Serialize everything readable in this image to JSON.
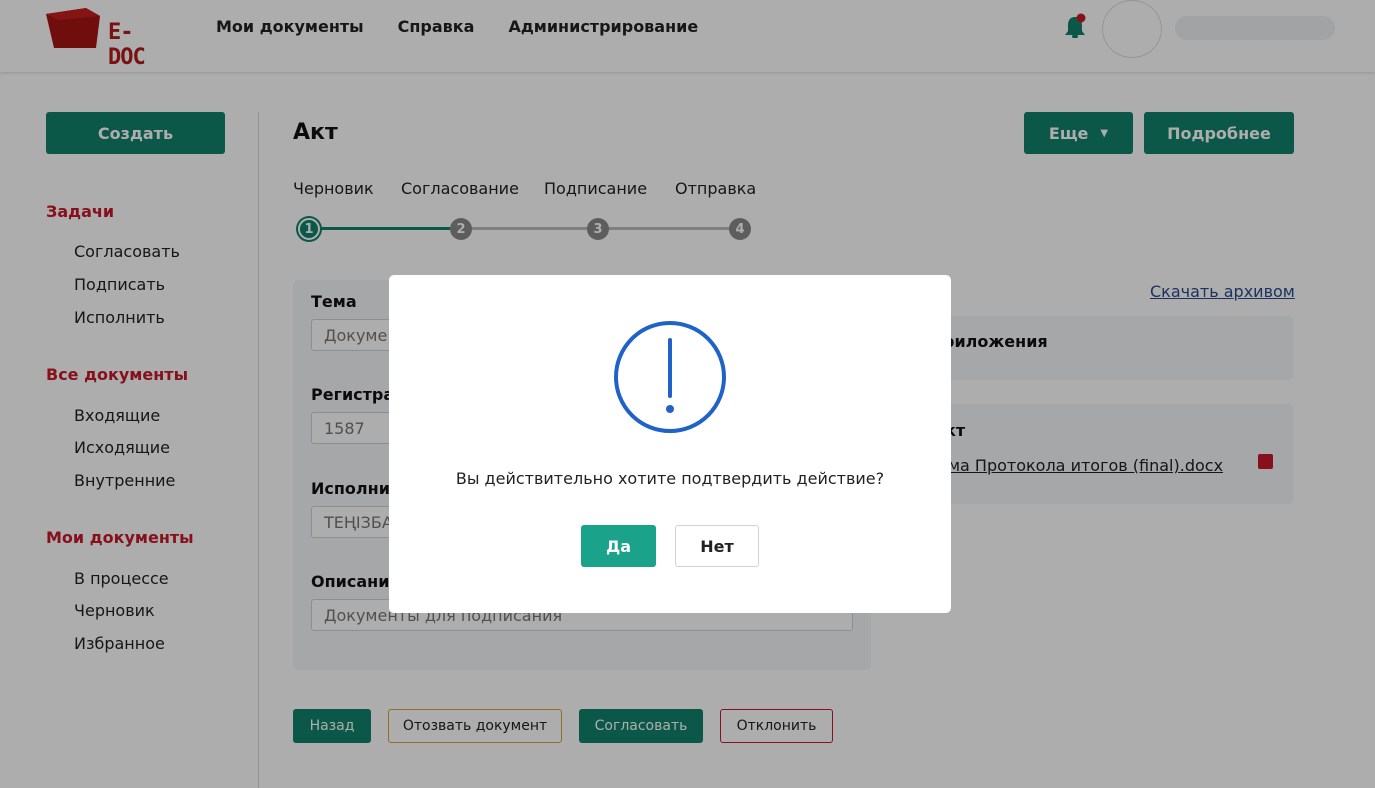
{
  "header": {
    "logo_text": "E-DOC",
    "nav": [
      "Мои документы",
      "Справка",
      "Администрирование"
    ]
  },
  "sidebar": {
    "create_label": "Создать",
    "sections": [
      {
        "title": "Задачи",
        "items": [
          "Согласовать",
          "Подписать",
          "Исполнить"
        ]
      },
      {
        "title": "Все документы",
        "items": [
          "Входящие",
          "Исходящие",
          "Внутренние"
        ]
      },
      {
        "title": "Мои документы",
        "items": [
          "В процессе",
          "Черновик",
          "Избранное"
        ]
      }
    ]
  },
  "main": {
    "title": "Акт",
    "more_label": "Еще",
    "details_label": "Подробнее",
    "steps": [
      {
        "label": "Черновик",
        "number": "1"
      },
      {
        "label": "Согласование",
        "number": "2"
      },
      {
        "label": "Подписание",
        "number": "3"
      },
      {
        "label": "Отправка",
        "number": "4"
      }
    ],
    "form": {
      "topic_label": "Тема",
      "topic_value": "Докуме",
      "reg_label": "Регистра",
      "reg_value": "1587",
      "executor_label": "Исполни",
      "executor_value": "ТЕҢІЗБА",
      "desc_label": "Описани",
      "desc_value": "Документы для подписания"
    },
    "attachments": {
      "download_label": "Скачать архивом",
      "section1_title": "риложения",
      "section2_title": "кт",
      "file_name": "орма Протокола итогов (final).docx"
    },
    "bottom_buttons": {
      "back": "Назад",
      "withdraw": "Отозвать документ",
      "approve": "Согласовать",
      "reject": "Отклонить"
    }
  },
  "modal": {
    "message": "Вы действительно хотите подтвердить действие?",
    "yes_label": "Да",
    "no_label": "Нет",
    "icon": "exclamation-circle-icon"
  },
  "colors": {
    "accent_green": "#11806a",
    "modal_yes": "#1aa38a",
    "brand_red": "#c8182a",
    "modal_icon_blue": "#1f63c9"
  }
}
